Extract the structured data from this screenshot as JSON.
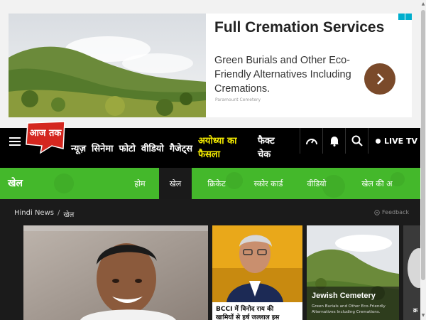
{
  "ad": {
    "title": "Full Cremation Services",
    "text": "Green Burials and Other Eco-Friendly Alternatives Including Cremations.",
    "sponsor": "Paramount Cemetery",
    "arrow_icon": "chevron-right-icon"
  },
  "header": {
    "logo_text": "आज तक",
    "nav": [
      "न्यूज़",
      "सिनेमा",
      "फोटो",
      "वीडियो",
      "गैजेट्स"
    ],
    "highlight": "अयोध्या का फैसला",
    "extra": "फैक्ट चेक",
    "live_tv": "LIVE TV"
  },
  "section": {
    "title": "खेल",
    "tabs": [
      "होम",
      "खेल",
      "क्रिकेट",
      "स्कोर कार्ड",
      "वीडियो",
      "खेल की अ"
    ],
    "active_tab": "खेल"
  },
  "breadcrumb": {
    "home": "Hindi News",
    "sep": "/",
    "current": "खेल"
  },
  "feedback": "Feedback",
  "cards": {
    "card2_caption": "BCCI में विनोद राय की",
    "card2_caption2": "खामियों से हर्ष जल्लाल इस",
    "card3_title": "Jewish Cemetery",
    "card3_text": "Green Burials and Other Eco-Friendly Alternatives Including Cremations.",
    "card4_text": "क्र"
  },
  "colors": {
    "brand_red": "#d4271f",
    "section_green": "#44b82b",
    "highlight_yellow": "#f5ec00",
    "nav_bg": "#000000"
  }
}
